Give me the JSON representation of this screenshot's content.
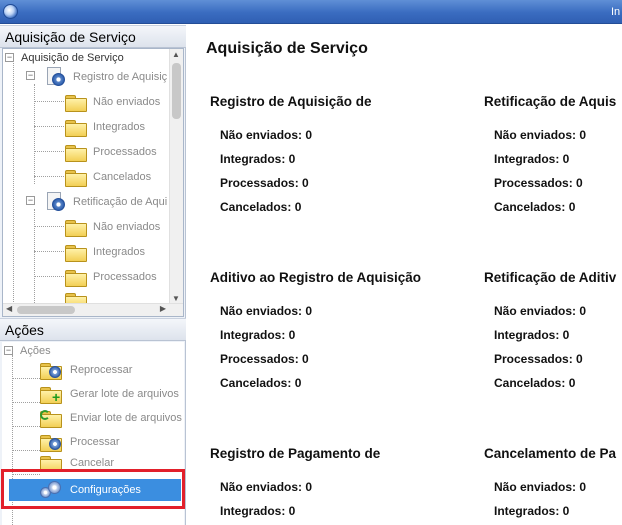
{
  "window": {
    "title": "In"
  },
  "left_top": {
    "header": "Aquisição de Serviço",
    "tree": [
      {
        "label": "Aquisição de Serviço"
      },
      {
        "label": "Registro de Aquisiç"
      },
      {
        "label": "Não enviados"
      },
      {
        "label": "Integrados"
      },
      {
        "label": "Processados"
      },
      {
        "label": "Cancelados"
      },
      {
        "label": "Retificação de Aqui"
      },
      {
        "label": "Não enviados"
      },
      {
        "label": "Integrados"
      },
      {
        "label": "Processados"
      }
    ]
  },
  "left_bottom": {
    "header": "Ações",
    "root": "Ações",
    "actions": [
      {
        "label": "Reprocessar"
      },
      {
        "label": "Gerar lote de arquivos"
      },
      {
        "label": "Enviar lote de arquivos"
      },
      {
        "label": "Processar"
      },
      {
        "label": "Cancelar"
      },
      {
        "label": "Configurações"
      }
    ]
  },
  "main": {
    "title": "Aquisição de Serviço",
    "cards": [
      {
        "title": "Registro de Aquisição de",
        "rows": [
          "Não enviados: 0",
          "Integrados: 0",
          "Processados: 0",
          "Cancelados: 0"
        ]
      },
      {
        "title": "Retificação de Aquis",
        "rows": [
          "Não enviados: 0",
          "Integrados: 0",
          "Processados: 0",
          "Cancelados: 0"
        ]
      },
      {
        "title": "Aditivo ao Registro de Aquisição",
        "rows": [
          "Não enviados: 0",
          "Integrados: 0",
          "Processados: 0",
          "Cancelados: 0"
        ]
      },
      {
        "title": "Retificação de Aditiv",
        "rows": [
          "Não enviados: 0",
          "Integrados: 0",
          "Processados: 0",
          "Cancelados: 0"
        ]
      },
      {
        "title": "Registro de Pagamento de",
        "rows": [
          "Não enviados: 0",
          "Integrados: 0"
        ]
      },
      {
        "title": "Cancelamento de Pa",
        "rows": [
          "Não enviados: 0",
          "Integrados: 0"
        ]
      }
    ]
  },
  "colors": {
    "selection": "#3b8ee0",
    "highlight_border": "#e2202b",
    "titlebar": "#3a6cc0"
  }
}
